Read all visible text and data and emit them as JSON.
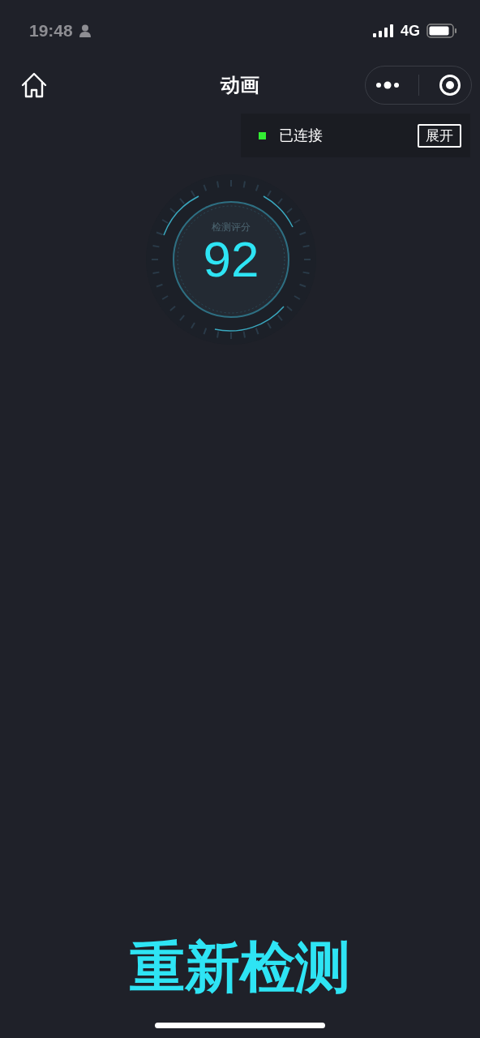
{
  "status_bar": {
    "time": "19:48",
    "network": "4G"
  },
  "nav": {
    "title": "动画"
  },
  "connection": {
    "status": "已连接",
    "color": "#33ee33",
    "button": "展开"
  },
  "score": {
    "label": "检测评分",
    "value": "92"
  },
  "action": {
    "label": "重新检测"
  }
}
